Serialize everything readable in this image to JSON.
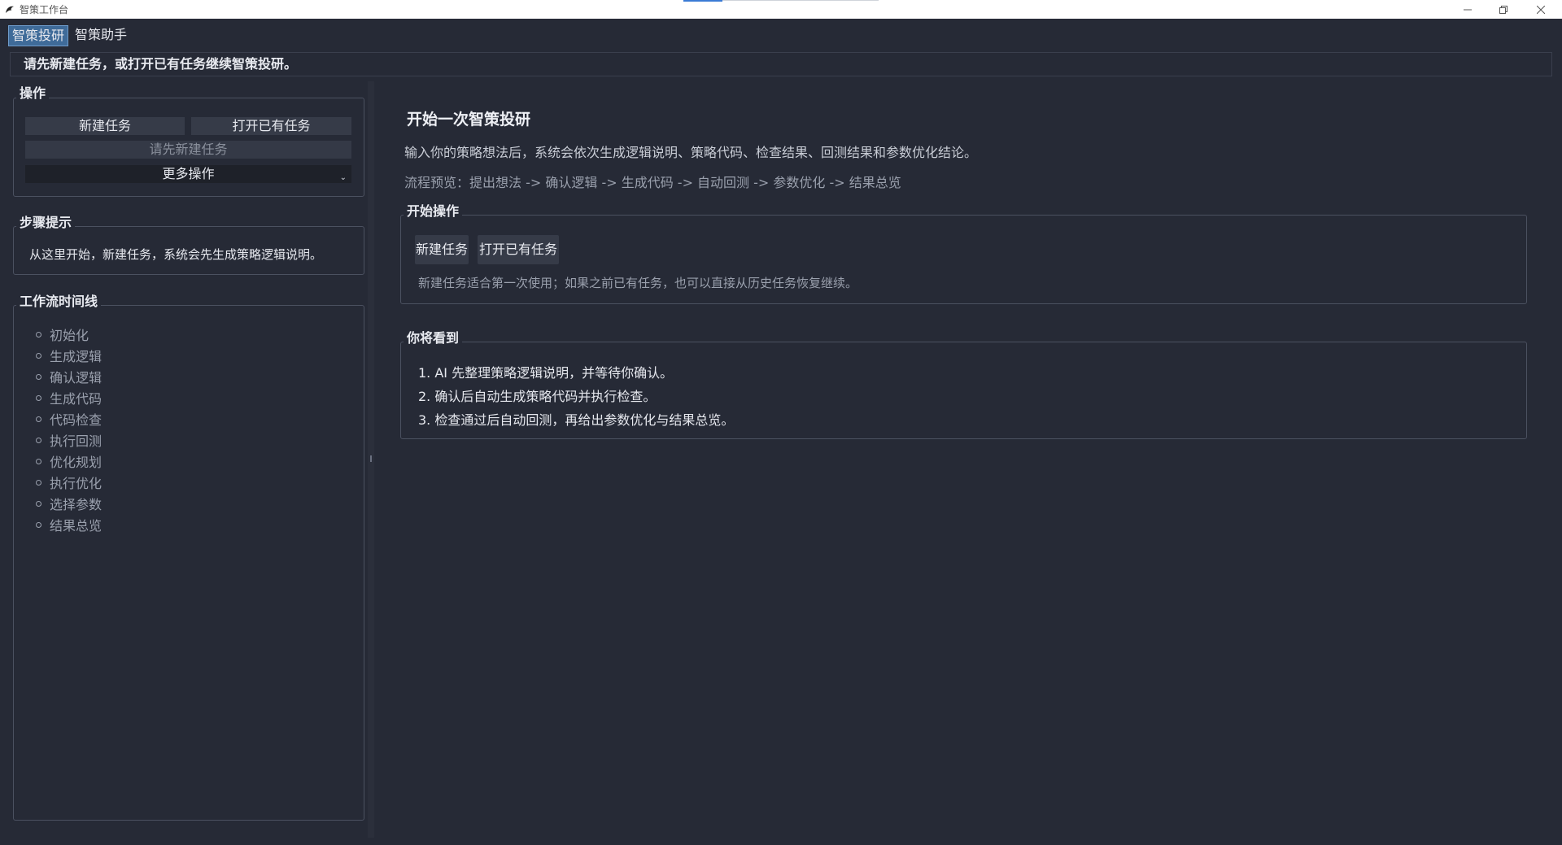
{
  "window": {
    "title": "智策工作台"
  },
  "tabs": [
    {
      "label": "智策投研",
      "active": true
    },
    {
      "label": "智策助手",
      "active": false
    }
  ],
  "hint_bar": {
    "text": "请先新建任务，或打开已有任务继续智策投研。"
  },
  "sidebar": {
    "actions": {
      "title": "操作",
      "new_task": "新建任务",
      "open_task": "打开已有任务",
      "disabled_hint": "请先新建任务",
      "more_actions": "更多操作"
    },
    "step_hint": {
      "title": "步骤提示",
      "text": "从这里开始，新建任务，系统会先生成策略逻辑说明。"
    },
    "timeline": {
      "title": "工作流时间线",
      "items": [
        "初始化",
        "生成逻辑",
        "确认逻辑",
        "生成代码",
        "代码检查",
        "执行回测",
        "优化规划",
        "执行优化",
        "选择参数",
        "结果总览"
      ]
    }
  },
  "main": {
    "title": "开始一次智策投研",
    "description": "输入你的策略想法后，系统会依次生成逻辑说明、策略代码、检查结果、回测结果和参数优化结论。",
    "flow_preview": "流程预览：提出想法 -> 确认逻辑 -> 生成代码 -> 自动回测 -> 参数优化 -> 结果总览",
    "start_section": {
      "title": "开始操作",
      "new_task": "新建任务",
      "open_task": "打开已有任务",
      "note": "新建任务适合第一次使用；如果之前已有任务，也可以直接从历史任务恢复继续。"
    },
    "see_section": {
      "title": "你将看到",
      "items": [
        "1. AI 先整理策略逻辑说明，并等待你确认。",
        "2. 确认后自动生成策略代码并执行检查。",
        "3. 检查通过后自动回测，再给出参数优化与结果总览。"
      ]
    }
  },
  "colors": {
    "background": "#262a36",
    "accent_tab": "#3f6b99",
    "button": "#363b48",
    "border": "#4b5160"
  }
}
